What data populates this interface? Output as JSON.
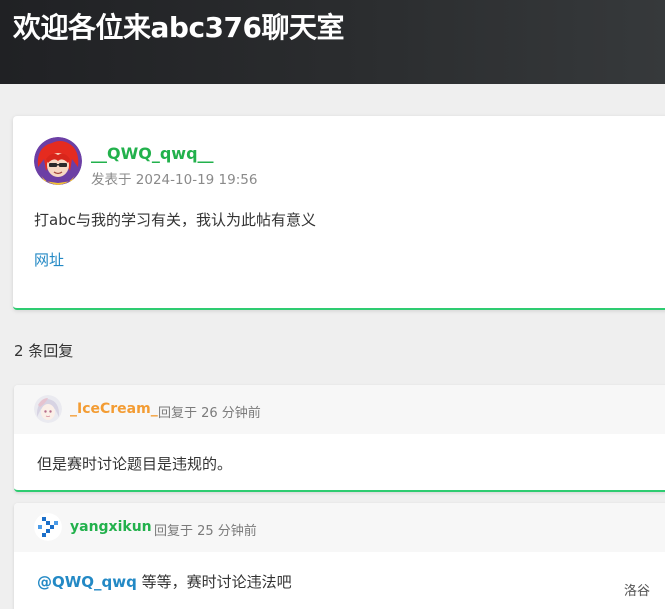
{
  "header": {
    "title": "欢迎各位来abc376聊天室"
  },
  "post": {
    "author": "__QWQ_qwq__",
    "meta": "发表于 2024-10-19 19:56",
    "content": "打abc与我的学习有关，我认为此帖有意义",
    "link_label": "网址",
    "accent_color": "#22b14c",
    "avatar_icon": "red-haired-anime-avatar-icon"
  },
  "replies_header": {
    "count_text": "2 条回复"
  },
  "replies": [
    {
      "author": "_IceCream_",
      "author_color": "#f39c33",
      "meta": "回复于 26 分钟前",
      "body": "但是赛时讨论题目是违规的。",
      "avatar_icon": "anime-girl-avatar-icon"
    },
    {
      "author": "yangxikun",
      "author_color": "#22b14c",
      "meta": "回复于 25 分钟前",
      "mention": "@QWQ_qwq",
      "body_rest": " 等等，赛时讨论违法吧",
      "avatar_icon": "blue-pixel-logo-avatar-icon"
    }
  ],
  "watermark": "洛谷"
}
